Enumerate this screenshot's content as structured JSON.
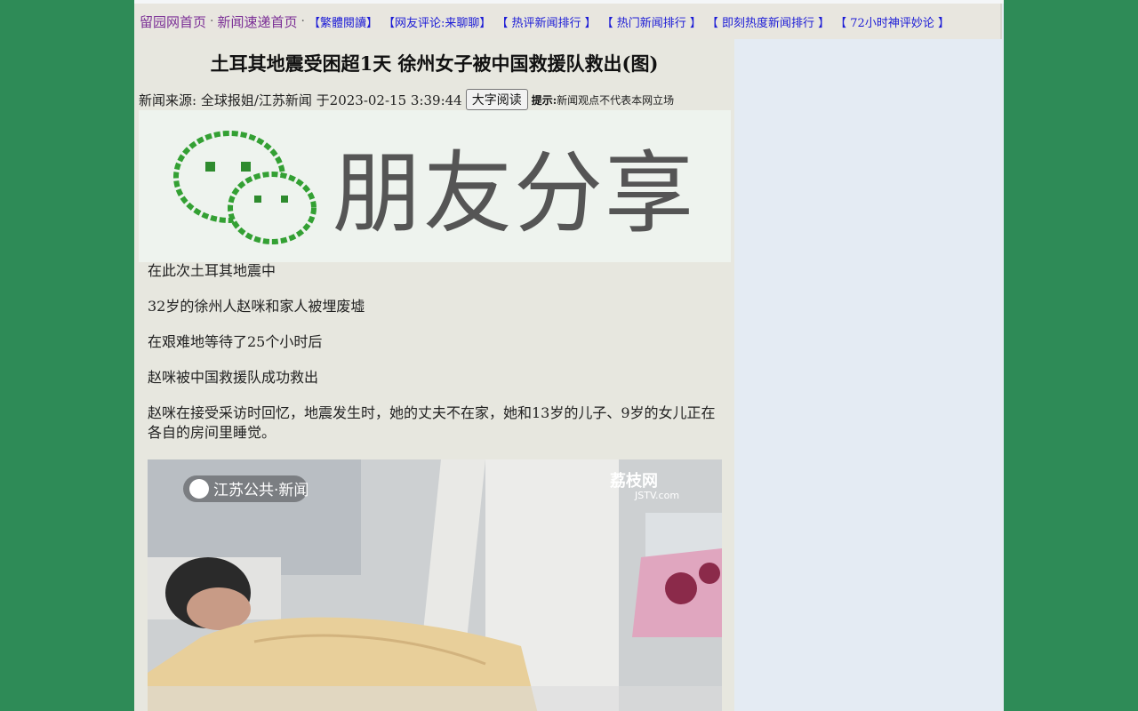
{
  "nav": {
    "home": "留园网首页",
    "sep1": "·",
    "news_home": "新闻速递首页",
    "sep2": "·",
    "links": [
      "【繁體閱讀】",
      "【网友评论:来聊聊】",
      "【 热评新闻排行 】",
      "【 热门新闻排行 】",
      "【 即刻热度新闻排行 】",
      "【 72小时神评妙论 】"
    ]
  },
  "article": {
    "title": "土耳其地震受困超1天 徐州女子被中国救援队救出(图)",
    "meta": "新闻来源: 全球报姐/江苏新闻 于2023-02-15 3:39:44",
    "big_font_button": "大字阅读",
    "tip_label": "提示:",
    "tip_text": "新闻观点不代表本网立场",
    "banner_text": "朋友分享",
    "banner_icon": "wechat-icon",
    "paragraphs": [
      "在此次土耳其地震中",
      "32岁的徐州人赵咪和家人被埋废墟",
      "在艰难地等待了25个小时后",
      "赵咪被中国救援队成功救出",
      "赵咪在接受采访时回忆，地震发生时，她的丈夫不在家，她和13岁的儿子、9岁的女儿正在各自的房间里睡觉。"
    ],
    "photo_watermark_left": "江苏公共·新闻",
    "photo_watermark_right": "荔枝网",
    "photo_watermark_right_sub": "JSTV.com"
  },
  "colors": {
    "background": "#2e8b57",
    "nav_link": "#1b1bd6",
    "nav_main": "#7b2f96"
  }
}
